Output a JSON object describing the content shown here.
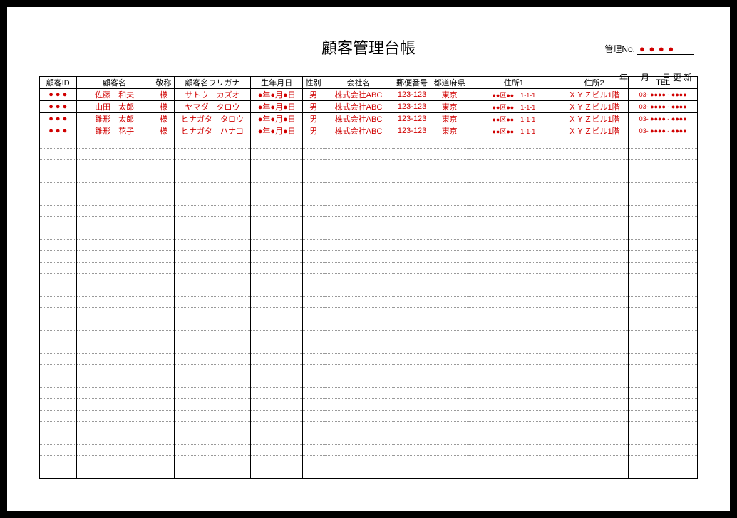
{
  "header": {
    "kanri_label": "管理No.",
    "kanri_value": "● ● ● ●",
    "date_line": "年　月　日更新"
  },
  "title": "顧客管理台帳",
  "columns": [
    "顧客ID",
    "顧客名",
    "敬称",
    "顧客名フリガナ",
    "生年月日",
    "性別",
    "会社名",
    "郵便番号",
    "都道府県",
    "住所1",
    "住所2",
    "TEL"
  ],
  "rows": [
    {
      "id": "● ● ●",
      "name": "佐藤　和夫",
      "title": "様",
      "kana": "サトウ　カズオ",
      "birth": "●年●月●日",
      "sex": "男",
      "company": "株式会社ABC",
      "zip": "123-123",
      "pref": "東京",
      "addr1": "●●区●●　1-1-1",
      "addr2": "ＸＹＺビル1階",
      "tel": "03- ●●●● - ●●●●"
    },
    {
      "id": "● ● ●",
      "name": "山田　太郎",
      "title": "様",
      "kana": "ヤマダ　タロウ",
      "birth": "●年●月●日",
      "sex": "男",
      "company": "株式会社ABC",
      "zip": "123-123",
      "pref": "東京",
      "addr1": "●●区●●　1-1-1",
      "addr2": "ＸＹＺビル1階",
      "tel": "03- ●●●● - ●●●●"
    },
    {
      "id": "● ● ●",
      "name": "雛形　太郎",
      "title": "様",
      "kana": "ヒナガタ　タロウ",
      "birth": "●年●月●日",
      "sex": "男",
      "company": "株式会社ABC",
      "zip": "123-123",
      "pref": "東京",
      "addr1": "●●区●●　1-1-1",
      "addr2": "ＸＹＺビル1階",
      "tel": "03- ●●●● - ●●●●"
    },
    {
      "id": "● ● ●",
      "name": "雛形　花子",
      "title": "様",
      "kana": "ヒナガタ　ハナコ",
      "birth": "●年●月●日",
      "sex": "男",
      "company": "株式会社ABC",
      "zip": "123-123",
      "pref": "東京",
      "addr1": "●●区●●　1-1-1",
      "addr2": "ＸＹＺビル1階",
      "tel": "03- ●●●● - ●●●●"
    }
  ],
  "empty_rows": 30
}
